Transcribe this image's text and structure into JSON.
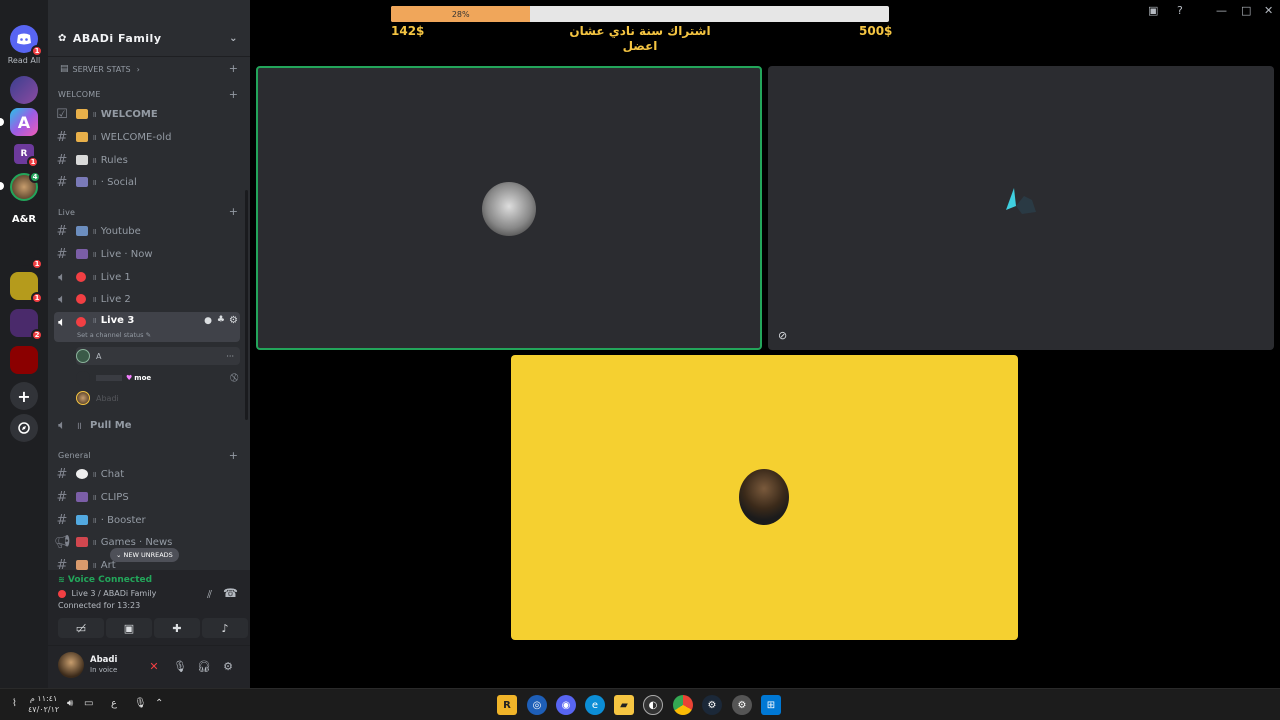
{
  "rail": {
    "read_all": "Read All",
    "ar_label": "A&R"
  },
  "guild": {
    "name": "ABADi Family"
  },
  "channels": {
    "server_stats": "SERVER STATS",
    "welcome_category": "WELCOME",
    "welcome": "WELCOME",
    "welcome_old": "WELCOME-old",
    "rules": "Rules",
    "social": "· Social",
    "live_category": "Live",
    "youtube": "Youtube",
    "live_now": "Live · Now",
    "live1": "Live 1",
    "live2": "Live 2",
    "live3": "Live 3",
    "channel_status": "Set a channel status",
    "voice_user_a": "A",
    "voice_user_moe": "moe",
    "voice_user_abadi": "Abadi",
    "pull_me": "Pull Me",
    "general_category": "General",
    "chat": "Chat",
    "clips": "CLIPS",
    "booster": "· Booster",
    "games_news": "Games · News",
    "art": "Art",
    "new_unreads": "NEW UNREADS"
  },
  "voice": {
    "title": "Voice Connected",
    "channel": "Live 3 / ABADi Family",
    "connected_for": "Connected for 13:23"
  },
  "user": {
    "name": "Abadi",
    "status": "In voice"
  },
  "stream": {
    "progress_label": "28%",
    "progress": 0.28,
    "goal_left": "142$",
    "goal_right": "500$",
    "goal_text_line1": "اشتراك سنة نادي عشان",
    "goal_text_line2": "اعضل"
  },
  "taskbar": {
    "time": "١١:٤١ م",
    "date": "٤٧/٠٢/١٢",
    "lang": "ع"
  },
  "colors": {
    "accent_green": "#23a55a",
    "gold": "#f5c542",
    "tile_yellow": "#f5d030",
    "mute_red": "#f23f43"
  }
}
